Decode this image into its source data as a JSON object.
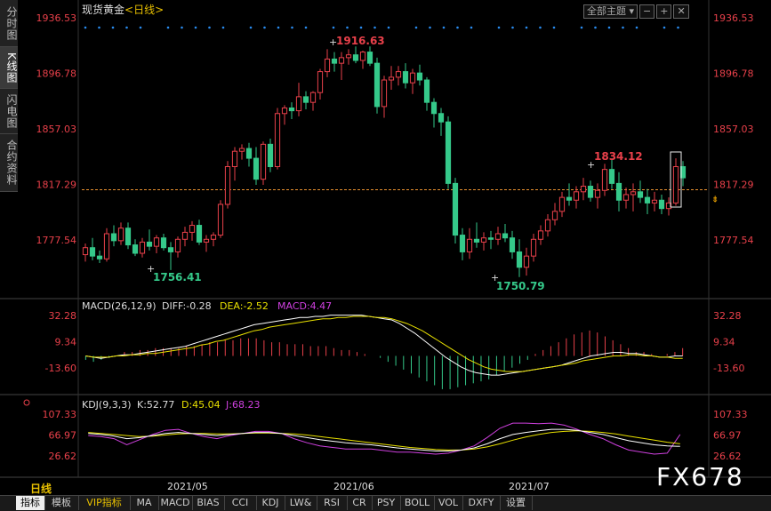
{
  "side_tabs": [
    "分时图",
    "K线图",
    "闪电图",
    "合约资料"
  ],
  "title": {
    "name": "现货黄金",
    "period": "<日线>"
  },
  "toolbar": {
    "theme_label": "全部主题"
  },
  "price_axis": {
    "ticks": [
      "1936.53",
      "1896.78",
      "1857.03",
      "1817.29",
      "1777.54"
    ]
  },
  "current_price": "1817.29",
  "annotations": {
    "high": "1916.63",
    "low1": "1756.41",
    "low2": "1750.79",
    "peak2": "1834.12"
  },
  "macd": {
    "label": "MACD(26,12,9)",
    "diff": "DIFF:-0.28",
    "dea": "DEA:-2.52",
    "macd": "MACD:4.47",
    "ticks": [
      "32.28",
      "9.34",
      "-13.60"
    ]
  },
  "kdj": {
    "label": "KDJ(9,3,3)",
    "k": "K:52.77",
    "d": "D:45.04",
    "j": "J:68.23",
    "ticks": [
      "107.33",
      "66.97",
      "26.62"
    ]
  },
  "date_labels": [
    "2021/05",
    "2021/06",
    "2021/07"
  ],
  "period_label": "日线",
  "bottom_tabs": [
    "指标",
    "模板",
    "VIP指标",
    "MA",
    "MACD",
    "BIAS",
    "CCI",
    "KDJ",
    "LW&",
    "RSI",
    "CR",
    "PSY",
    "BOLL",
    "VOL",
    "DXFY",
    "设置"
  ],
  "watermark": "FX678",
  "colors": {
    "up": "#e8404a",
    "down": "#35c98a",
    "diff": "#ffffff",
    "dea": "#e8e000",
    "kdj_k": "#ffffff",
    "kdj_d": "#e8e000",
    "kdj_j": "#d040e0",
    "dots": "#2a8cf0"
  },
  "chart_data": {
    "type": "candlestick",
    "x_labels": [
      "2021/05",
      "2021/06",
      "2021/07"
    ],
    "ylim": [
      1745,
      1940
    ],
    "ohlc": [
      [
        1767,
        1775,
        1762,
        1772
      ],
      [
        1772,
        1779,
        1763,
        1766
      ],
      [
        1766,
        1770,
        1761,
        1764
      ],
      [
        1764,
        1786,
        1762,
        1782
      ],
      [
        1782,
        1788,
        1773,
        1777
      ],
      [
        1777,
        1790,
        1774,
        1786
      ],
      [
        1786,
        1790,
        1771,
        1774
      ],
      [
        1774,
        1778,
        1766,
        1768
      ],
      [
        1768,
        1779,
        1765,
        1776
      ],
      [
        1776,
        1785,
        1770,
        1773
      ],
      [
        1773,
        1781,
        1768,
        1779
      ],
      [
        1779,
        1782,
        1770,
        1772
      ],
      [
        1772,
        1776,
        1756,
        1769
      ],
      [
        1769,
        1780,
        1765,
        1778
      ],
      [
        1778,
        1787,
        1773,
        1783
      ],
      [
        1783,
        1791,
        1777,
        1788
      ],
      [
        1788,
        1792,
        1774,
        1776
      ],
      [
        1776,
        1781,
        1769,
        1778
      ],
      [
        1778,
        1783,
        1773,
        1781
      ],
      [
        1781,
        1806,
        1779,
        1803
      ],
      [
        1803,
        1834,
        1800,
        1830
      ],
      [
        1830,
        1844,
        1820,
        1841
      ],
      [
        1841,
        1846,
        1835,
        1843
      ],
      [
        1843,
        1847,
        1830,
        1836
      ],
      [
        1836,
        1844,
        1817,
        1821
      ],
      [
        1821,
        1848,
        1817,
        1846
      ],
      [
        1846,
        1850,
        1826,
        1830
      ],
      [
        1830,
        1872,
        1828,
        1868
      ],
      [
        1868,
        1874,
        1860,
        1872
      ],
      [
        1872,
        1876,
        1864,
        1870
      ],
      [
        1870,
        1890,
        1866,
        1880
      ],
      [
        1880,
        1884,
        1871,
        1876
      ],
      [
        1876,
        1884,
        1870,
        1883
      ],
      [
        1883,
        1900,
        1878,
        1898
      ],
      [
        1898,
        1914,
        1894,
        1907
      ],
      [
        1907,
        1912,
        1898,
        1904
      ],
      [
        1904,
        1912,
        1892,
        1908
      ],
      [
        1908,
        1914,
        1903,
        1910
      ],
      [
        1910,
        1916,
        1904,
        1906
      ],
      [
        1906,
        1913,
        1900,
        1912
      ],
      [
        1912,
        1916,
        1902,
        1904
      ],
      [
        1904,
        1908,
        1868,
        1873
      ],
      [
        1873,
        1895,
        1865,
        1892
      ],
      [
        1892,
        1902,
        1885,
        1894
      ],
      [
        1894,
        1902,
        1888,
        1898
      ],
      [
        1898,
        1904,
        1886,
        1890
      ],
      [
        1890,
        1900,
        1882,
        1897
      ],
      [
        1897,
        1903,
        1888,
        1892
      ],
      [
        1892,
        1894,
        1870,
        1876
      ],
      [
        1876,
        1879,
        1858,
        1868
      ],
      [
        1868,
        1872,
        1852,
        1862
      ],
      [
        1862,
        1866,
        1814,
        1818
      ],
      [
        1818,
        1822,
        1775,
        1781
      ],
      [
        1781,
        1786,
        1763,
        1769
      ],
      [
        1769,
        1786,
        1764,
        1778
      ],
      [
        1778,
        1790,
        1772,
        1776
      ],
      [
        1776,
        1783,
        1770,
        1779
      ],
      [
        1779,
        1784,
        1771,
        1778
      ],
      [
        1778,
        1787,
        1774,
        1782
      ],
      [
        1782,
        1789,
        1776,
        1779
      ],
      [
        1779,
        1784,
        1764,
        1769
      ],
      [
        1769,
        1778,
        1751,
        1758
      ],
      [
        1758,
        1772,
        1752,
        1766
      ],
      [
        1766,
        1782,
        1762,
        1778
      ],
      [
        1778,
        1788,
        1774,
        1784
      ],
      [
        1784,
        1796,
        1780,
        1792
      ],
      [
        1792,
        1804,
        1788,
        1798
      ],
      [
        1798,
        1812,
        1794,
        1808
      ],
      [
        1808,
        1818,
        1802,
        1806
      ],
      [
        1806,
        1816,
        1800,
        1812
      ],
      [
        1812,
        1822,
        1806,
        1816
      ],
      [
        1816,
        1820,
        1805,
        1808
      ],
      [
        1808,
        1818,
        1800,
        1813
      ],
      [
        1813,
        1832,
        1809,
        1828
      ],
      [
        1828,
        1836,
        1814,
        1818
      ],
      [
        1818,
        1826,
        1798,
        1806
      ],
      [
        1806,
        1815,
        1800,
        1810
      ],
      [
        1810,
        1818,
        1798,
        1812
      ],
      [
        1812,
        1820,
        1804,
        1808
      ],
      [
        1808,
        1814,
        1796,
        1804
      ],
      [
        1804,
        1812,
        1798,
        1806
      ],
      [
        1806,
        1810,
        1796,
        1800
      ],
      [
        1800,
        1808,
        1795,
        1804
      ],
      [
        1804,
        1836,
        1802,
        1830
      ],
      [
        1830,
        1834,
        1816,
        1822
      ]
    ],
    "macd": {
      "diff": [
        0,
        -1,
        -2,
        -1,
        0,
        1,
        1,
        2,
        3,
        4,
        5,
        6,
        7,
        8,
        10,
        12,
        14,
        16,
        18,
        20,
        22,
        24,
        26,
        27,
        28,
        29,
        30,
        31,
        32,
        32,
        33,
        33,
        34,
        34,
        34,
        34,
        34,
        33,
        32,
        31,
        30,
        27,
        23,
        19,
        14,
        9,
        4,
        -1,
        -5,
        -9,
        -12,
        -14,
        -15,
        -16,
        -16,
        -15,
        -14,
        -13,
        -12,
        -11,
        -10,
        -9,
        -8,
        -6,
        -4,
        -2,
        0,
        1,
        2,
        3,
        3,
        2,
        2,
        1,
        0,
        -1,
        -1,
        0,
        0
      ],
      "dea": [
        0,
        -1,
        -1,
        -1,
        0,
        0,
        1,
        1,
        2,
        2,
        3,
        4,
        5,
        6,
        7,
        9,
        10,
        12,
        13,
        15,
        17,
        19,
        21,
        22,
        24,
        25,
        26,
        27,
        28,
        29,
        30,
        31,
        31,
        32,
        32,
        33,
        33,
        33,
        32,
        32,
        31,
        29,
        27,
        24,
        21,
        17,
        13,
        9,
        5,
        1,
        -3,
        -6,
        -9,
        -11,
        -12,
        -13,
        -13,
        -13,
        -12,
        -11,
        -10,
        -9,
        -8,
        -7,
        -6,
        -4,
        -3,
        -2,
        -1,
        0,
        0,
        1,
        1,
        0,
        0,
        -1,
        -1,
        -2,
        -2
      ],
      "hist": [
        -2,
        -3,
        -2,
        -1,
        0,
        2,
        2,
        3,
        3,
        4,
        4,
        4,
        4,
        5,
        5,
        6,
        7,
        7,
        8,
        8,
        9,
        9,
        9,
        8,
        7,
        7,
        6,
        6,
        6,
        5,
        5,
        5,
        4,
        3,
        3,
        2,
        1,
        0,
        -1,
        -3,
        -5,
        -7,
        -9,
        -11,
        -13,
        -15,
        -17,
        -17,
        -16,
        -15,
        -14,
        -13,
        -12,
        -10,
        -8,
        -6,
        -4,
        -2,
        1,
        3,
        5,
        7,
        9,
        11,
        12,
        13,
        12,
        10,
        8,
        6,
        4,
        2,
        2,
        1,
        0,
        1,
        2,
        4
      ]
    },
    "kdj": {
      "k": [
        70,
        68,
        65,
        60,
        62,
        66,
        70,
        72,
        70,
        68,
        66,
        68,
        70,
        72,
        72,
        70,
        66,
        62,
        58,
        55,
        52,
        50,
        48,
        45,
        42,
        40,
        38,
        36,
        36,
        38,
        42,
        50,
        60,
        68,
        72,
        75,
        78,
        78,
        76,
        72,
        68,
        62,
        56,
        52,
        48,
        46,
        45
      ],
      "d": [
        72,
        70,
        68,
        66,
        64,
        65,
        67,
        69,
        70,
        70,
        69,
        69,
        70,
        71,
        71,
        70,
        69,
        67,
        64,
        61,
        58,
        55,
        52,
        49,
        46,
        43,
        41,
        39,
        38,
        38,
        40,
        44,
        50,
        57,
        63,
        68,
        72,
        74,
        75,
        74,
        72,
        69,
        65,
        61,
        57,
        53,
        50
      ],
      "j": [
        66,
        64,
        60,
        48,
        58,
        68,
        76,
        78,
        70,
        64,
        60,
        66,
        70,
        74,
        74,
        70,
        60,
        52,
        46,
        43,
        40,
        40,
        40,
        37,
        34,
        34,
        32,
        30,
        32,
        38,
        46,
        62,
        80,
        90,
        90,
        89,
        90,
        86,
        78,
        68,
        60,
        48,
        38,
        34,
        30,
        32,
        68
      ]
    }
  }
}
